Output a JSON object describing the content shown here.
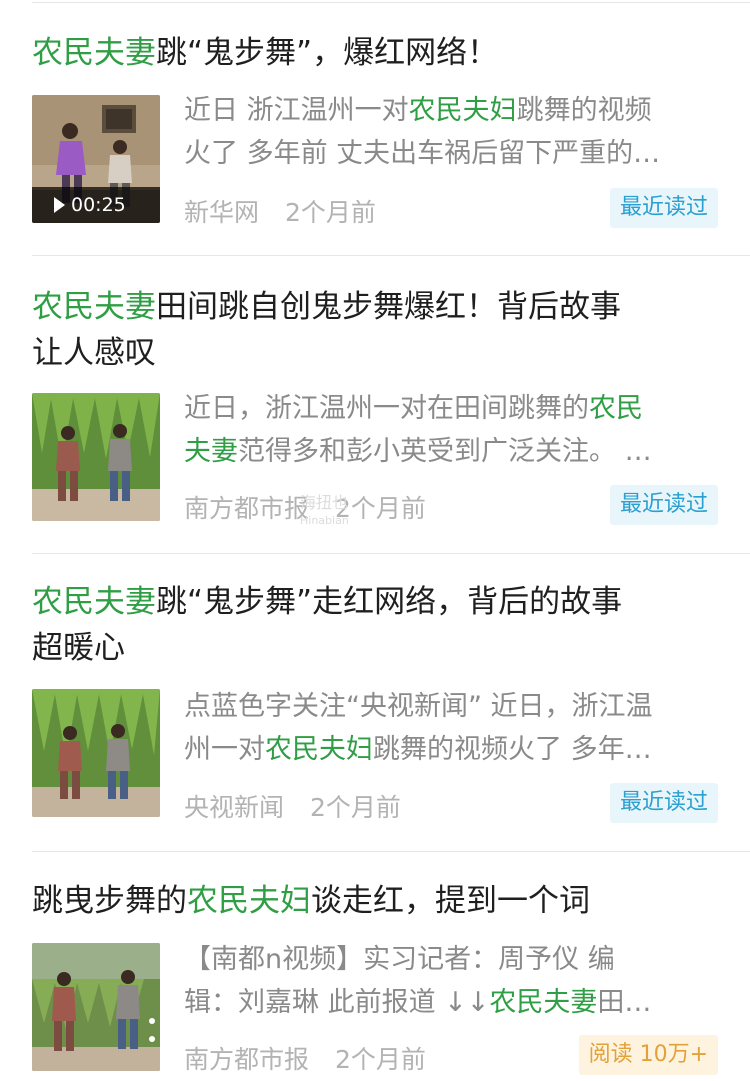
{
  "articles": [
    {
      "title": [
        [
          {
            "t": "农民夫妻",
            "hl": true
          },
          {
            "t": "跳“鬼步舞”，爆红网络！",
            "hl": false
          }
        ]
      ],
      "excerpt": [
        [
          {
            "t": "近日 浙江温州一对",
            "hl": false
          },
          {
            "t": "农民夫妇",
            "hl": true
          },
          {
            "t": "跳舞的视频",
            "hl": false
          }
        ],
        [
          {
            "t": "火了 多年前 丈夫出车祸后留下严重的…",
            "hl": false
          }
        ]
      ],
      "source": "新华网",
      "time": "2个月前",
      "badge": "最近读过",
      "badge_type": "read",
      "duration": "00:25",
      "thumb_icon": "dancing-couple-video-thumbnail"
    },
    {
      "title": [
        [
          {
            "t": "农民夫妻",
            "hl": true
          },
          {
            "t": "田间跳自创鬼步舞爆红！背后故事",
            "hl": false
          }
        ],
        [
          {
            "t": "让人感叹",
            "hl": false
          }
        ]
      ],
      "excerpt": [
        [
          {
            "t": "近日，浙江温州一对在田间跳舞的",
            "hl": false
          },
          {
            "t": "农民",
            "hl": true
          }
        ],
        [
          {
            "t": "夫妻",
            "hl": true
          },
          {
            "t": "范得多和彭小英受到广泛关注。 …",
            "hl": false
          }
        ]
      ],
      "source": "南方都市报",
      "time": "2个月前",
      "badge": "最近读过",
      "badge_type": "read",
      "thumb_icon": "cornfield-dance-thumbnail"
    },
    {
      "title": [
        [
          {
            "t": "农民夫妻",
            "hl": true
          },
          {
            "t": "跳“鬼步舞”走红网络，背后的故事",
            "hl": false
          }
        ],
        [
          {
            "t": "超暖心",
            "hl": false
          }
        ]
      ],
      "excerpt": [
        [
          {
            "t": "点蓝色字关注“央视新闻” 近日，浙江温",
            "hl": false
          }
        ],
        [
          {
            "t": "州一对",
            "hl": false
          },
          {
            "t": "农民夫妇",
            "hl": true
          },
          {
            "t": "跳舞的视频火了 多年…",
            "hl": false
          }
        ]
      ],
      "source": "央视新闻",
      "time": "2个月前",
      "badge": "最近读过",
      "badge_type": "read",
      "thumb_icon": "cornfield-dance-thumbnail"
    },
    {
      "title": [
        [
          {
            "t": "跳曳步舞的",
            "hl": false
          },
          {
            "t": "农民夫妇",
            "hl": true
          },
          {
            "t": "谈走红，提到一个词",
            "hl": false
          }
        ]
      ],
      "excerpt": [
        [
          {
            "t": "【南都n视频】实习记者：周予仪 编",
            "hl": false
          }
        ],
        [
          {
            "t": "辑：刘嘉琳 此前报道 ↓↓",
            "hl": false
          },
          {
            "t": "农民夫妻",
            "hl": true
          },
          {
            "t": "田…",
            "hl": false
          }
        ]
      ],
      "source": "南方都市报",
      "time": "2个月前",
      "badge": "阅读 10万+",
      "badge_type": "hot",
      "thumb_icon": "cornfield-dance-thumbnail"
    }
  ],
  "colors": {
    "highlight": "#2f9e44",
    "badge_read_bg": "#e8f6fb",
    "badge_read_text": "#2a9fd0",
    "badge_hot_bg": "#fdf3de",
    "badge_hot_text": "#e3a13a"
  }
}
